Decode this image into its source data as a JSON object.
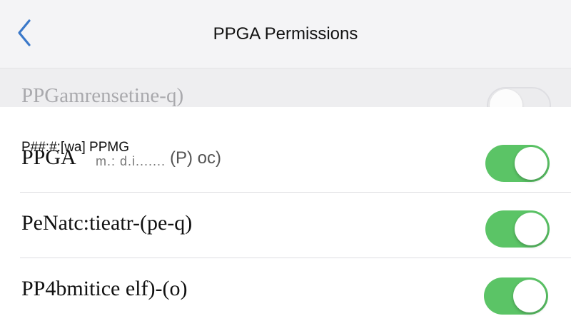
{
  "navbar": {
    "title": "PPGA Permissions",
    "back_icon": "chevron-left-icon",
    "accent": "#3a78c9"
  },
  "rows": [
    {
      "label": "PPGamrensetine-q)",
      "enabled": false
    },
    {
      "label": "PPGA",
      "overlay_label": "P##:#:[wa] PPMG",
      "sub_label": "m.: d.i.......",
      "aux_label": "(P) oc)",
      "enabled": true
    },
    {
      "label": "PeNatc:tieatr-(pe-q)",
      "enabled": true
    },
    {
      "label": "PP4bmitice elf)-(o)",
      "enabled": true
    }
  ],
  "colors": {
    "toggle_on": "#5bc466",
    "toggle_off": "#ececee"
  }
}
